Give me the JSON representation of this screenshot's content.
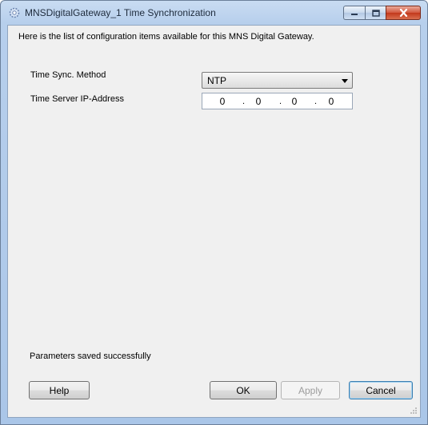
{
  "window": {
    "title": "MNSDigitalGateway_1 Time Synchronization",
    "icon": "gear-icon"
  },
  "content": {
    "intro_text": "Here is the list of configuration items available for this MNS Digital Gateway.",
    "fields": {
      "time_sync_method": {
        "label": "Time Sync. Method",
        "value": "NTP"
      },
      "time_server_ip": {
        "label": "Time Server IP-Address",
        "octets": [
          "0",
          "0",
          "0",
          "0"
        ]
      }
    },
    "status_text": "Parameters saved successfully"
  },
  "buttons": {
    "help": "Help",
    "ok": "OK",
    "apply": "Apply",
    "cancel": "Cancel"
  },
  "colors": {
    "title_bar": "#b7cfec",
    "client_bg": "#f0f0f0",
    "close_button": "#c2381b"
  }
}
